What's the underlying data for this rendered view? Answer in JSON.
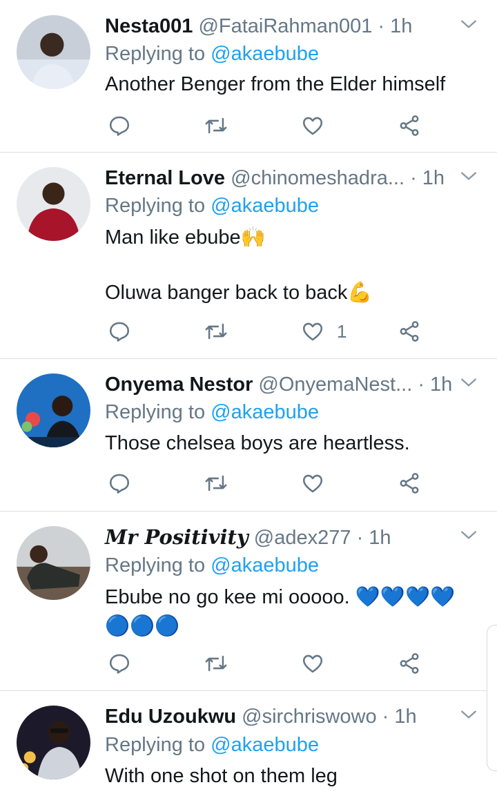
{
  "replying_prefix": "Replying to",
  "tweets": [
    {
      "name": "Nesta001",
      "handle": "@FataiRahman001",
      "time": "· 1h",
      "mention": "@akaebube",
      "text": "Another Benger from the Elder himself",
      "like_count": ""
    },
    {
      "name": "Eternal Love",
      "handle": "@chinomeshadra...",
      "time": "· 1h",
      "mention": "@akaebube",
      "text": "Man like ebube🙌\n\nOluwa banger back to back💪",
      "like_count": "1"
    },
    {
      "name": "Onyema Nestor",
      "handle": "@OnyemaNest...",
      "time": "· 1h",
      "mention": "@akaebube",
      "text": "Those chelsea boys are heartless.",
      "like_count": ""
    },
    {
      "name": "Mr Positivity",
      "handle": "@adex277",
      "time": "· 1h",
      "mention": "@akaebube",
      "text": "Ebube no go kee mi ooooo. 💙💙💙💙\n🔵🔵🔵",
      "like_count": ""
    },
    {
      "name": "Edu Uzoukwu",
      "handle": "@sirchriswowo",
      "time": "· 1h",
      "mention": "@akaebube",
      "text": "With one shot on them leg",
      "like_count": ""
    }
  ],
  "colors": {
    "accent": "#1da1f2",
    "muted": "#657786",
    "text": "#14171a",
    "divider": "#dcdfe2"
  },
  "icons": [
    "reply-icon",
    "retweet-icon",
    "like-icon",
    "share-icon",
    "chevron-down-icon"
  ]
}
